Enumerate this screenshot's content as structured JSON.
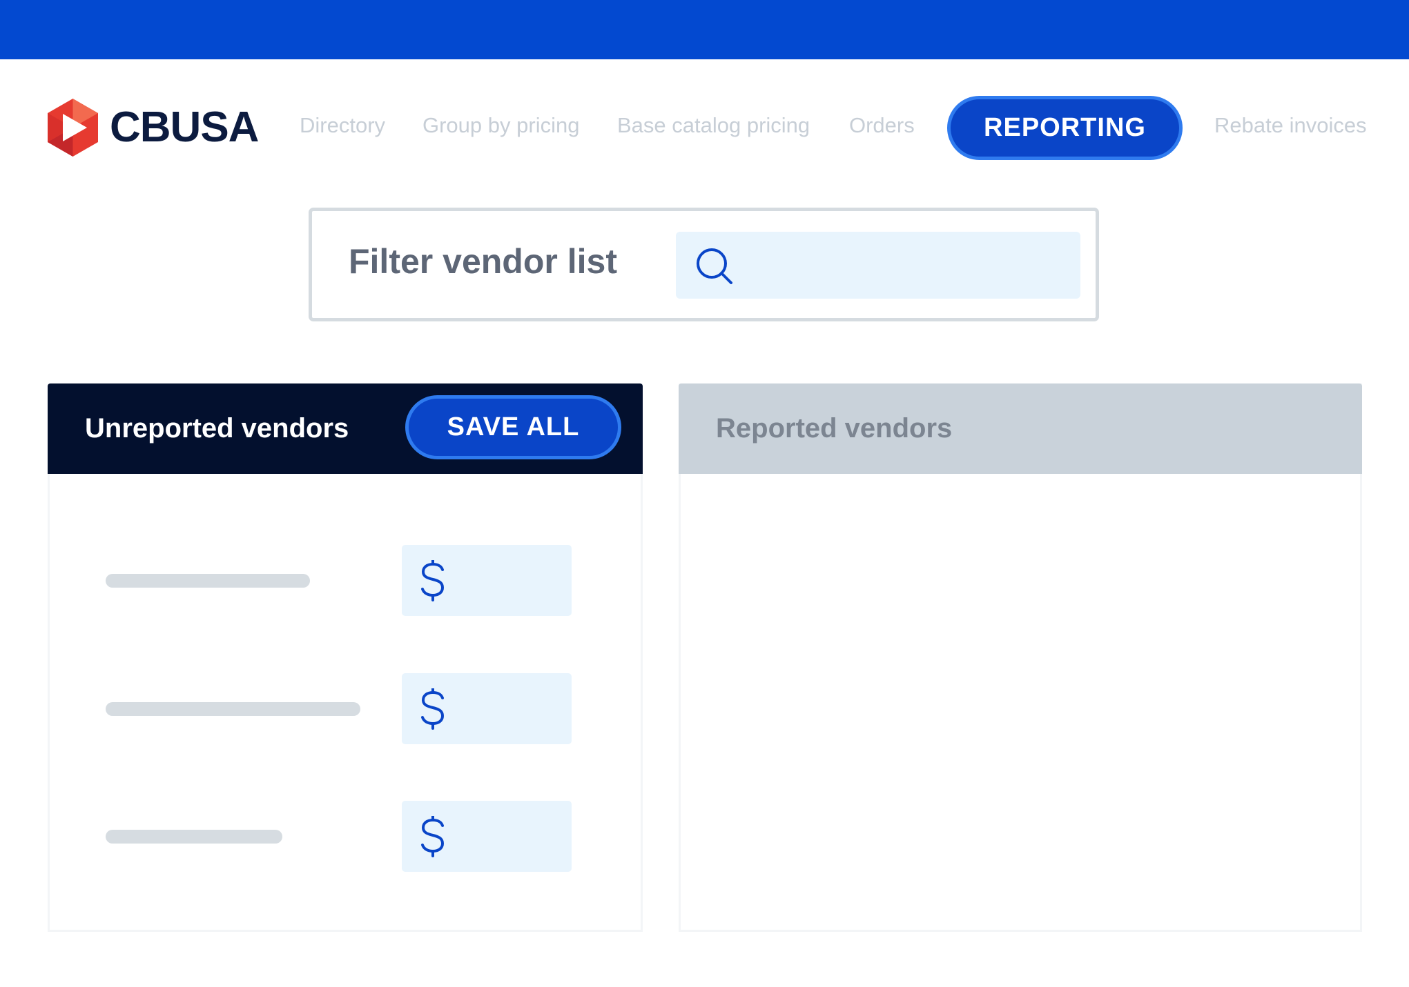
{
  "brand": {
    "name": "CBUSA",
    "logo_colors": [
      "#e63a30",
      "#c4272a",
      "#f26a4f"
    ],
    "text_color": "#0c1b3f"
  },
  "colors": {
    "top_bar": "#0349d0",
    "primary_button": "#0a45c8",
    "primary_button_border": "#2f7bef",
    "nav_inactive": "#c7ced6",
    "dark_header": "#03102e",
    "light_header": "#c9d2da",
    "input_bg": "#e8f4fd",
    "icon_blue": "#0a45c8"
  },
  "nav": {
    "items": [
      {
        "label": "Directory",
        "active": false
      },
      {
        "label": "Group by pricing",
        "active": false
      },
      {
        "label": "Base catalog pricing",
        "active": false
      },
      {
        "label": "Orders",
        "active": false
      },
      {
        "label": "REPORTING",
        "active": true
      },
      {
        "label": "Rebate invoices",
        "active": false
      }
    ]
  },
  "filter": {
    "label": "Filter vendor list",
    "value": "",
    "icon": "search-icon"
  },
  "panels": {
    "unreported": {
      "title": "Unreported vendors",
      "action_label": "SAVE ALL",
      "rows": [
        {
          "amount": "",
          "icon": "dollar-icon"
        },
        {
          "amount": "",
          "icon": "dollar-icon"
        },
        {
          "amount": "",
          "icon": "dollar-icon"
        }
      ]
    },
    "reported": {
      "title": "Reported vendors",
      "rows": []
    }
  }
}
